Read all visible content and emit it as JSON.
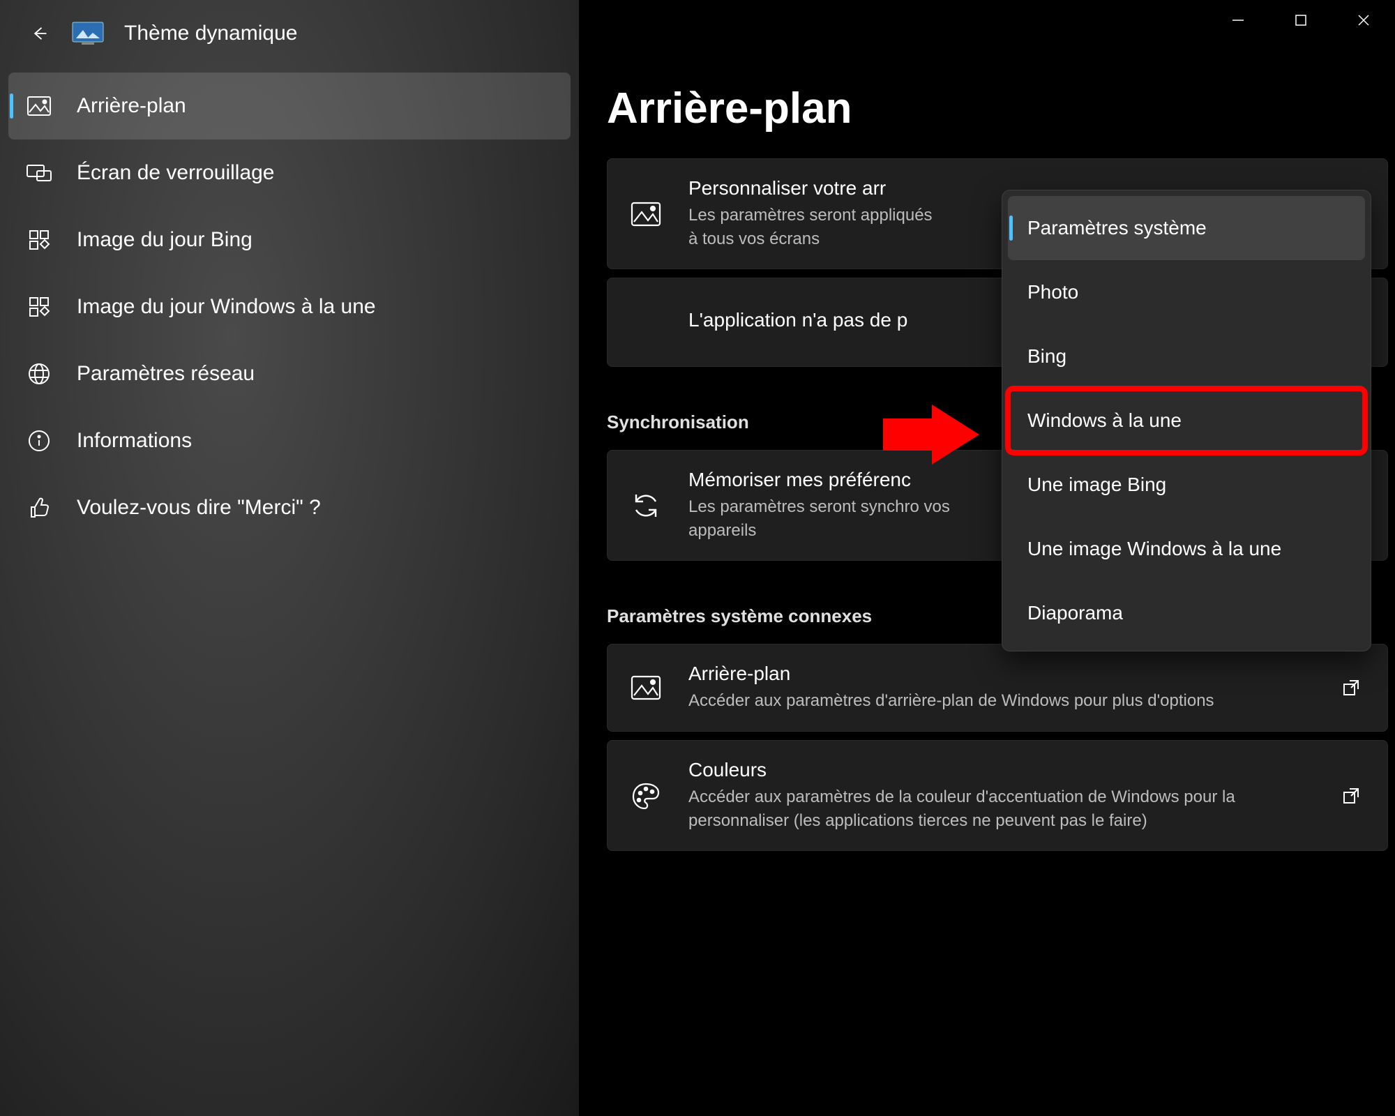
{
  "app": {
    "title": "Thème dynamique"
  },
  "sidebar": {
    "items": [
      {
        "label": "Arrière-plan"
      },
      {
        "label": "Écran de verrouillage"
      },
      {
        "label": "Image du jour Bing"
      },
      {
        "label": "Image du jour Windows à la une"
      },
      {
        "label": "Paramètres réseau"
      },
      {
        "label": "Informations"
      },
      {
        "label": "Voulez-vous dire \"Merci\" ?"
      }
    ]
  },
  "page": {
    "title": "Arrière-plan"
  },
  "cards": {
    "customize": {
      "title": "Personnaliser votre arr",
      "sub": "Les paramètres seront appliqués à tous vos écrans"
    },
    "noperm": {
      "title": "L'application n'a pas de p"
    },
    "sync_section": "Synchronisation",
    "sync": {
      "title": "Mémoriser mes préférenc",
      "sub": "Les paramètres seront synchro                              vos appareils"
    },
    "related_section": "Paramètres système connexes",
    "bg": {
      "title": "Arrière-plan",
      "sub": "Accéder aux paramètres d'arrière-plan de Windows pour plus d'options"
    },
    "colors": {
      "title": "Couleurs",
      "sub": "Accéder aux paramètres de la couleur d'accentuation de Windows pour la personnaliser (les applications tierces ne peuvent pas le faire)"
    }
  },
  "dropdown": {
    "items": [
      "Paramètres système",
      "Photo",
      "Bing",
      "Windows à la une",
      "Une image Bing",
      "Une image Windows à la une",
      "Diaporama"
    ]
  }
}
